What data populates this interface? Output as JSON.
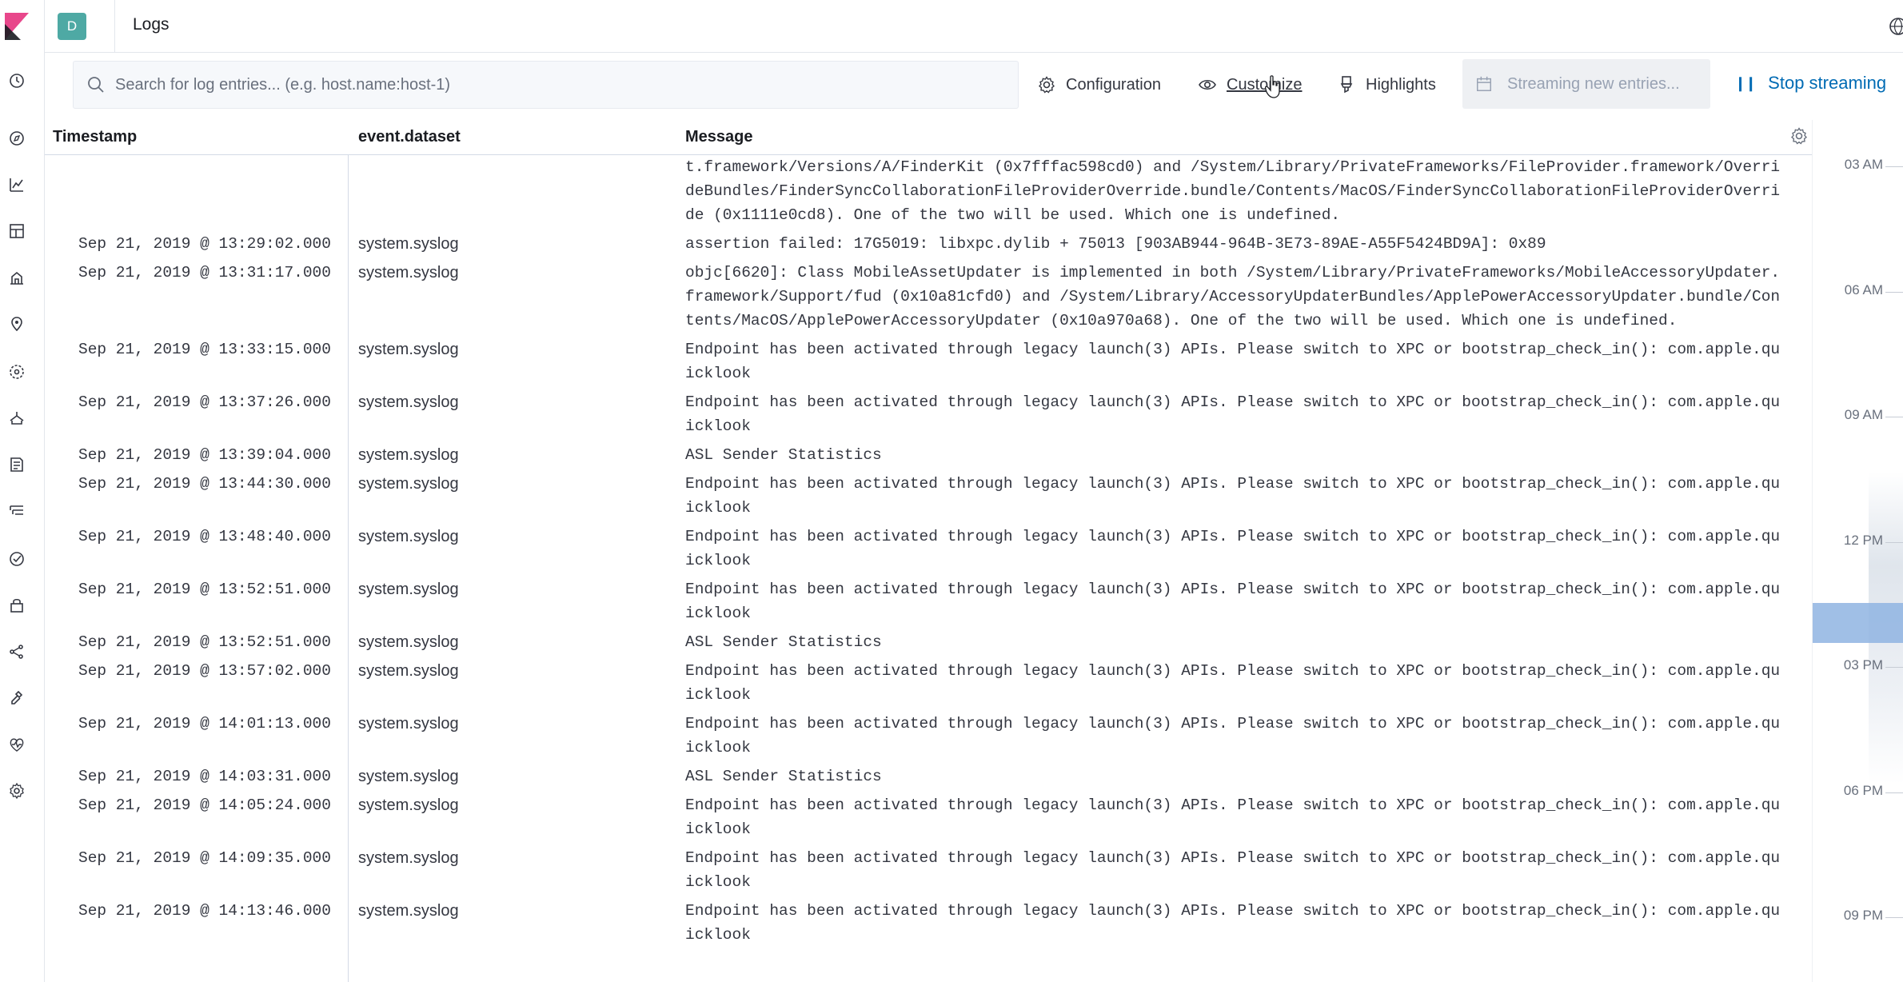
{
  "header": {
    "space_initial": "D",
    "title": "Logs"
  },
  "nav_icons": [
    "clock-icon",
    "compass-icon",
    "visualize-icon",
    "dashboard-icon",
    "canvas-icon",
    "maps-icon",
    "ml-icon",
    "infrastructure-icon",
    "logs-icon",
    "apm-icon",
    "uptime-icon",
    "siem-icon",
    "graph-icon",
    "dev-tools-icon",
    "monitoring-icon",
    "management-icon"
  ],
  "toolbar": {
    "search_placeholder": "Search for log entries... (e.g. host.name:host-1)",
    "configuration_label": "Configuration",
    "customize_label": "Customize",
    "highlights_label": "Highlights",
    "streaming_label": "Streaming new entries...",
    "stop_label": "Stop streaming"
  },
  "columns": {
    "timestamp": "Timestamp",
    "dataset": "event.dataset",
    "message": "Message"
  },
  "rows": [
    {
      "ts": "",
      "ds": "",
      "msg": "t.framework/Versions/A/FinderKit (0x7fffac598cd0) and /System/Library/PrivateFrameworks/FileProvider.framework/OverrideBundles/FinderSyncCollaborationFileProviderOverride.bundle/Contents/MacOS/FinderSyncCollaborationFileProviderOverride (0x1111e0cd8). One of the two will be used. Which one is undefined."
    },
    {
      "ts": "Sep 21, 2019 @ 13:29:02.000",
      "ds": "system.syslog",
      "msg": "assertion failed: 17G5019: libxpc.dylib + 75013 [903AB944-964B-3E73-89AE-A55F5424BD9A]: 0x89"
    },
    {
      "ts": "Sep 21, 2019 @ 13:31:17.000",
      "ds": "system.syslog",
      "msg": "objc[6620]: Class MobileAssetUpdater is implemented in both /System/Library/PrivateFrameworks/MobileAccessoryUpdater.framework/Support/fud (0x10a81cfd0) and /System/Library/AccessoryUpdaterBundles/ApplePowerAccessoryUpdater.bundle/Contents/MacOS/ApplePowerAccessoryUpdater (0x10a970a68). One of the two will be used. Which one is undefined."
    },
    {
      "ts": "Sep 21, 2019 @ 13:33:15.000",
      "ds": "system.syslog",
      "msg": "Endpoint has been activated through legacy launch(3) APIs. Please switch to XPC or bootstrap_check_in(): com.apple.quicklook"
    },
    {
      "ts": "Sep 21, 2019 @ 13:37:26.000",
      "ds": "system.syslog",
      "msg": "Endpoint has been activated through legacy launch(3) APIs. Please switch to XPC or bootstrap_check_in(): com.apple.quicklook"
    },
    {
      "ts": "Sep 21, 2019 @ 13:39:04.000",
      "ds": "system.syslog",
      "msg": "ASL Sender Statistics"
    },
    {
      "ts": "Sep 21, 2019 @ 13:44:30.000",
      "ds": "system.syslog",
      "msg": "Endpoint has been activated through legacy launch(3) APIs. Please switch to XPC or bootstrap_check_in(): com.apple.quicklook"
    },
    {
      "ts": "Sep 21, 2019 @ 13:48:40.000",
      "ds": "system.syslog",
      "msg": "Endpoint has been activated through legacy launch(3) APIs. Please switch to XPC or bootstrap_check_in(): com.apple.quicklook"
    },
    {
      "ts": "Sep 21, 2019 @ 13:52:51.000",
      "ds": "system.syslog",
      "msg": "Endpoint has been activated through legacy launch(3) APIs. Please switch to XPC or bootstrap_check_in(): com.apple.quicklook"
    },
    {
      "ts": "Sep 21, 2019 @ 13:52:51.000",
      "ds": "system.syslog",
      "msg": "ASL Sender Statistics"
    },
    {
      "ts": "Sep 21, 2019 @ 13:57:02.000",
      "ds": "system.syslog",
      "msg": "Endpoint has been activated through legacy launch(3) APIs. Please switch to XPC or bootstrap_check_in(): com.apple.quicklook"
    },
    {
      "ts": "Sep 21, 2019 @ 14:01:13.000",
      "ds": "system.syslog",
      "msg": "Endpoint has been activated through legacy launch(3) APIs. Please switch to XPC or bootstrap_check_in(): com.apple.quicklook"
    },
    {
      "ts": "Sep 21, 2019 @ 14:03:31.000",
      "ds": "system.syslog",
      "msg": "ASL Sender Statistics"
    },
    {
      "ts": "Sep 21, 2019 @ 14:05:24.000",
      "ds": "system.syslog",
      "msg": "Endpoint has been activated through legacy launch(3) APIs. Please switch to XPC or bootstrap_check_in(): com.apple.quicklook"
    },
    {
      "ts": "Sep 21, 2019 @ 14:09:35.000",
      "ds": "system.syslog",
      "msg": "Endpoint has been activated through legacy launch(3) APIs. Please switch to XPC or bootstrap_check_in(): com.apple.quicklook"
    },
    {
      "ts": "Sep 21, 2019 @ 14:13:46.000",
      "ds": "system.syslog",
      "msg": "Endpoint has been activated through legacy launch(3) APIs. Please switch to XPC or bootstrap_check_in(): com.apple.quicklook"
    }
  ],
  "minimap": {
    "ticks": [
      "03 AM",
      "06 AM",
      "09 AM",
      "12 PM",
      "03 PM",
      "06 PM",
      "09 PM"
    ],
    "highlight_color": "#8fb4e2"
  },
  "colors": {
    "accent": "#006bb4",
    "space_avatar": "#4ea9a4"
  }
}
